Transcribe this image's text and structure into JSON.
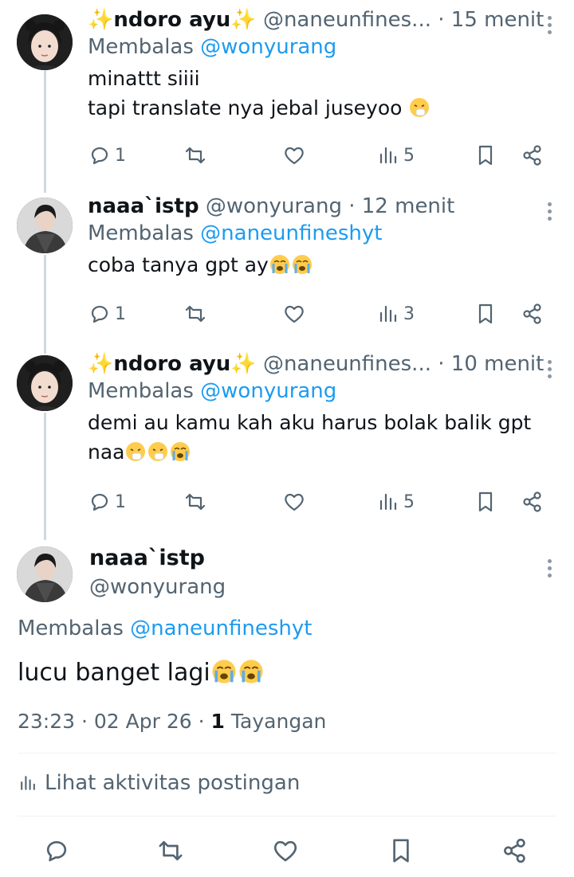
{
  "tweets": [
    {
      "name": "✨ndoro ayu✨",
      "handle": "@naneunfines...",
      "time": "· 15 menit",
      "reply_prefix": "Membalas",
      "reply_to": "@wonyurang",
      "text_lines": [
        "minattt siiii",
        "tapi translate nya jebal juseyoo"
      ],
      "replies": "1",
      "views": "5"
    },
    {
      "name": "naaa`istp",
      "handle": "@wonyurang",
      "time": "· 12 menit",
      "reply_prefix": "Membalas",
      "reply_to": "@naneunfineshyt",
      "text_lines": [
        "coba tanya gpt ay"
      ],
      "replies": "1",
      "views": "3"
    },
    {
      "name": "✨ndoro ayu✨",
      "handle": "@naneunfines...",
      "time": "· 10 menit",
      "reply_prefix": "Membalas",
      "reply_to": "@wonyurang",
      "text_lines": [
        "demi au kamu kah aku harus bolak balik gpt",
        "naa"
      ],
      "replies": "1",
      "views": "5"
    }
  ],
  "main_tweet": {
    "name": "naaa`istp",
    "handle": "@wonyurang",
    "reply_prefix": "Membalas",
    "reply_to": "@naneunfineshyt",
    "text": "lucu banget lagi",
    "time": "23:23",
    "date": "02 Apr 26",
    "views_count": "1",
    "views_label": "Tayangan",
    "activity_label": "Lihat aktivitas postingan"
  },
  "icons": {
    "reply": "reply-bubble-icon",
    "retweet": "retweet-icon",
    "like": "heart-icon",
    "views": "views-bar-chart-icon",
    "bookmark": "bookmark-icon",
    "share": "share-icon",
    "more": "more-vertical-icon"
  },
  "colors": {
    "mention": "#1d9bf0",
    "muted": "#536471",
    "text": "#0f1419",
    "thread_line": "#cfd9de"
  }
}
